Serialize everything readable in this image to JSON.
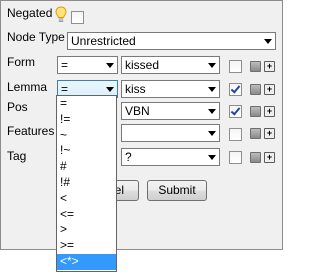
{
  "negated": {
    "label": "Negated",
    "checked": false
  },
  "node_type": {
    "label": "Node Type",
    "value": "Unrestricted"
  },
  "rows": {
    "form": {
      "label": "Form",
      "operator": "=",
      "value": "kissed",
      "checked": false
    },
    "lemma": {
      "label": "Lemma",
      "operator": "=",
      "value": "kiss",
      "checked": true
    },
    "pos": {
      "label": "Pos",
      "value": "VBN",
      "checked": true
    },
    "features": {
      "label": "Features",
      "value": "",
      "checked": false
    },
    "tag": {
      "label": "Tag",
      "value": "?",
      "checked": false
    }
  },
  "buttons": {
    "cancel_partial": "el",
    "submit": "Submit"
  },
  "operator_options": [
    "=",
    "!=",
    "~",
    "!~",
    "#",
    "!#",
    "<",
    "<=",
    ">",
    ">=",
    "<*>"
  ],
  "operator_highlighted": "<*>",
  "icons": {
    "hint": "lightbulb-icon",
    "minus": "minus-icon",
    "plus": "plus-icon"
  }
}
